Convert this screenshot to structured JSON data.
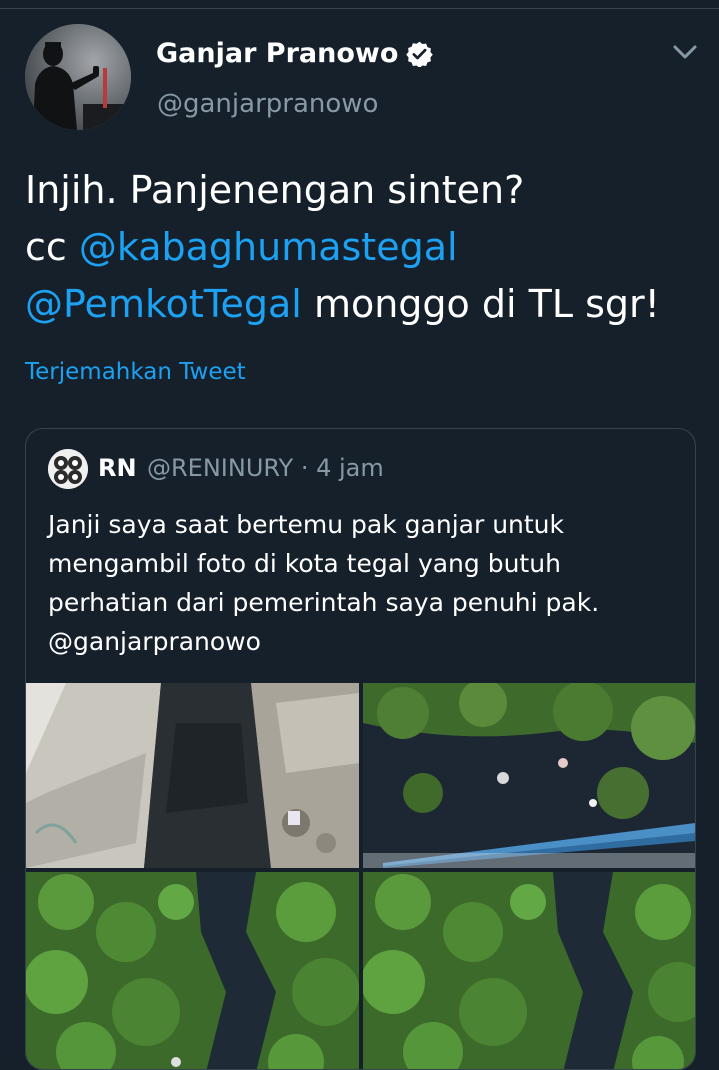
{
  "tweet": {
    "author_name": "Ganjar Pranowo",
    "author_handle": "@ganjarpranowo",
    "verified": true,
    "text_line1": "Injih. Panjenengan sinten?",
    "text_cc": "cc",
    "mention1": "@kabaghumastegal",
    "mention2": "@PemkotTegal",
    "text_tail": "monggo di TL sgr!",
    "translate_label": "Terjemahkan Tweet"
  },
  "quoted": {
    "name": "RN",
    "handle_time": "@RENINURY · 4 jam",
    "text_lines": [
      "Janji saya saat bertemu pak ganjar untuk",
      "mengambil foto di kota tegal yang butuh",
      "perhatian dari pemerintah saya penuhi pak.",
      "@ganjarpranowo"
    ]
  },
  "icons": {
    "verified": "verified-badge-icon",
    "more": "chevron-down-icon"
  },
  "colors": {
    "background": "#15202b",
    "border": "#38444d",
    "link": "#1da1f2",
    "secondary_text": "#8899a6",
    "primary_text": "#ffffff"
  }
}
